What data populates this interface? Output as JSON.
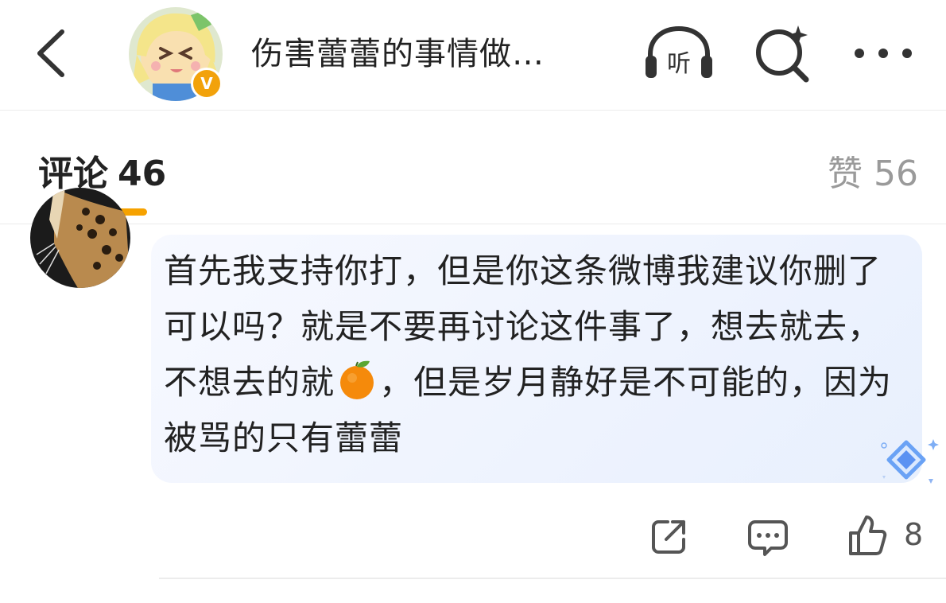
{
  "header": {
    "title": "伤害蕾蕾的事情做…",
    "verified_badge": "V",
    "icons": [
      "back-arrow-icon",
      "headphones-icon",
      "ai-search-icon",
      "more-dots-icon"
    ],
    "listen_label": "听"
  },
  "tabs": {
    "comments_label": "评论",
    "comments_count": "46",
    "likes_label": "赞",
    "likes_count": "56",
    "accent_color": "#f6a200"
  },
  "comment": {
    "text_before_emoji": "首先我支持你打，但是你这条微博我建议你删了可以吗？就是不要再讨论这件事了，想去就去，不想去的就",
    "emoji": "tangerine-emoji",
    "text_after_emoji": "，但是岁月静好是不可能的，因为被骂的只有蕾蕾",
    "like_count": "8",
    "actions": [
      "share-icon",
      "reply-icon",
      "thumbs-up-icon"
    ]
  }
}
